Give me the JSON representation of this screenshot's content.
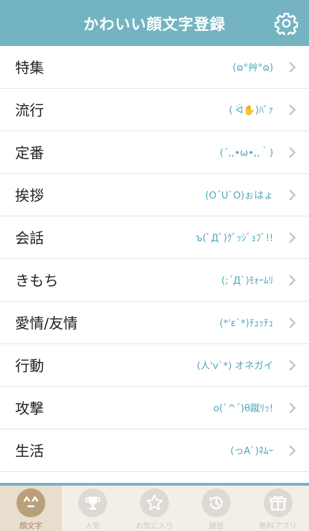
{
  "header": {
    "title": "かわいい顔文字登録",
    "settings_icon": "gear-icon"
  },
  "categories": [
    {
      "label": "特集",
      "face": "(ɷ°艸°ɷ)"
    },
    {
      "label": "流行",
      "face": "( ᐛ✋)ﾊﾟｧ"
    },
    {
      "label": "定番",
      "face": "(´,,•ω•,,｀)"
    },
    {
      "label": "挨拶",
      "face": "(O´U`O)ぉはょ"
    },
    {
      "label": "会話",
      "face": "ъ(ﾟДﾟ)ｸﾞｯｼﾞｮﾌﾞ!!"
    },
    {
      "label": "きもち",
      "face": "(;´Д`)ﾓｫｰﾑﾘ"
    },
    {
      "label": "愛情/友情",
      "face": "(*'ε`*)ﾁｭｯﾁｭ"
    },
    {
      "label": "行動",
      "face": "(人'v`*) オネガイ"
    },
    {
      "label": "攻撃",
      "face": "o(`^´)θ蹴ﾘｯ!"
    },
    {
      "label": "生活",
      "face": "(っA`)ﾈﾑｰ"
    }
  ],
  "tabs": [
    {
      "label": "顔文字",
      "icon": "kaomoji-face-icon",
      "active": true
    },
    {
      "label": "人気",
      "icon": "trophy-icon",
      "active": false
    },
    {
      "label": "お気に入り",
      "icon": "star-icon",
      "active": false
    },
    {
      "label": "履歴",
      "icon": "history-icon",
      "active": false
    },
    {
      "label": "無料アプリ",
      "icon": "gift-icon",
      "active": false
    }
  ],
  "colors": {
    "header": "#74b4c2",
    "face_text": "#4fa5bb",
    "tab_active": "#b8a07a",
    "tab_inactive": "#dedad3",
    "tabbar_bg": "#f4efe6"
  }
}
